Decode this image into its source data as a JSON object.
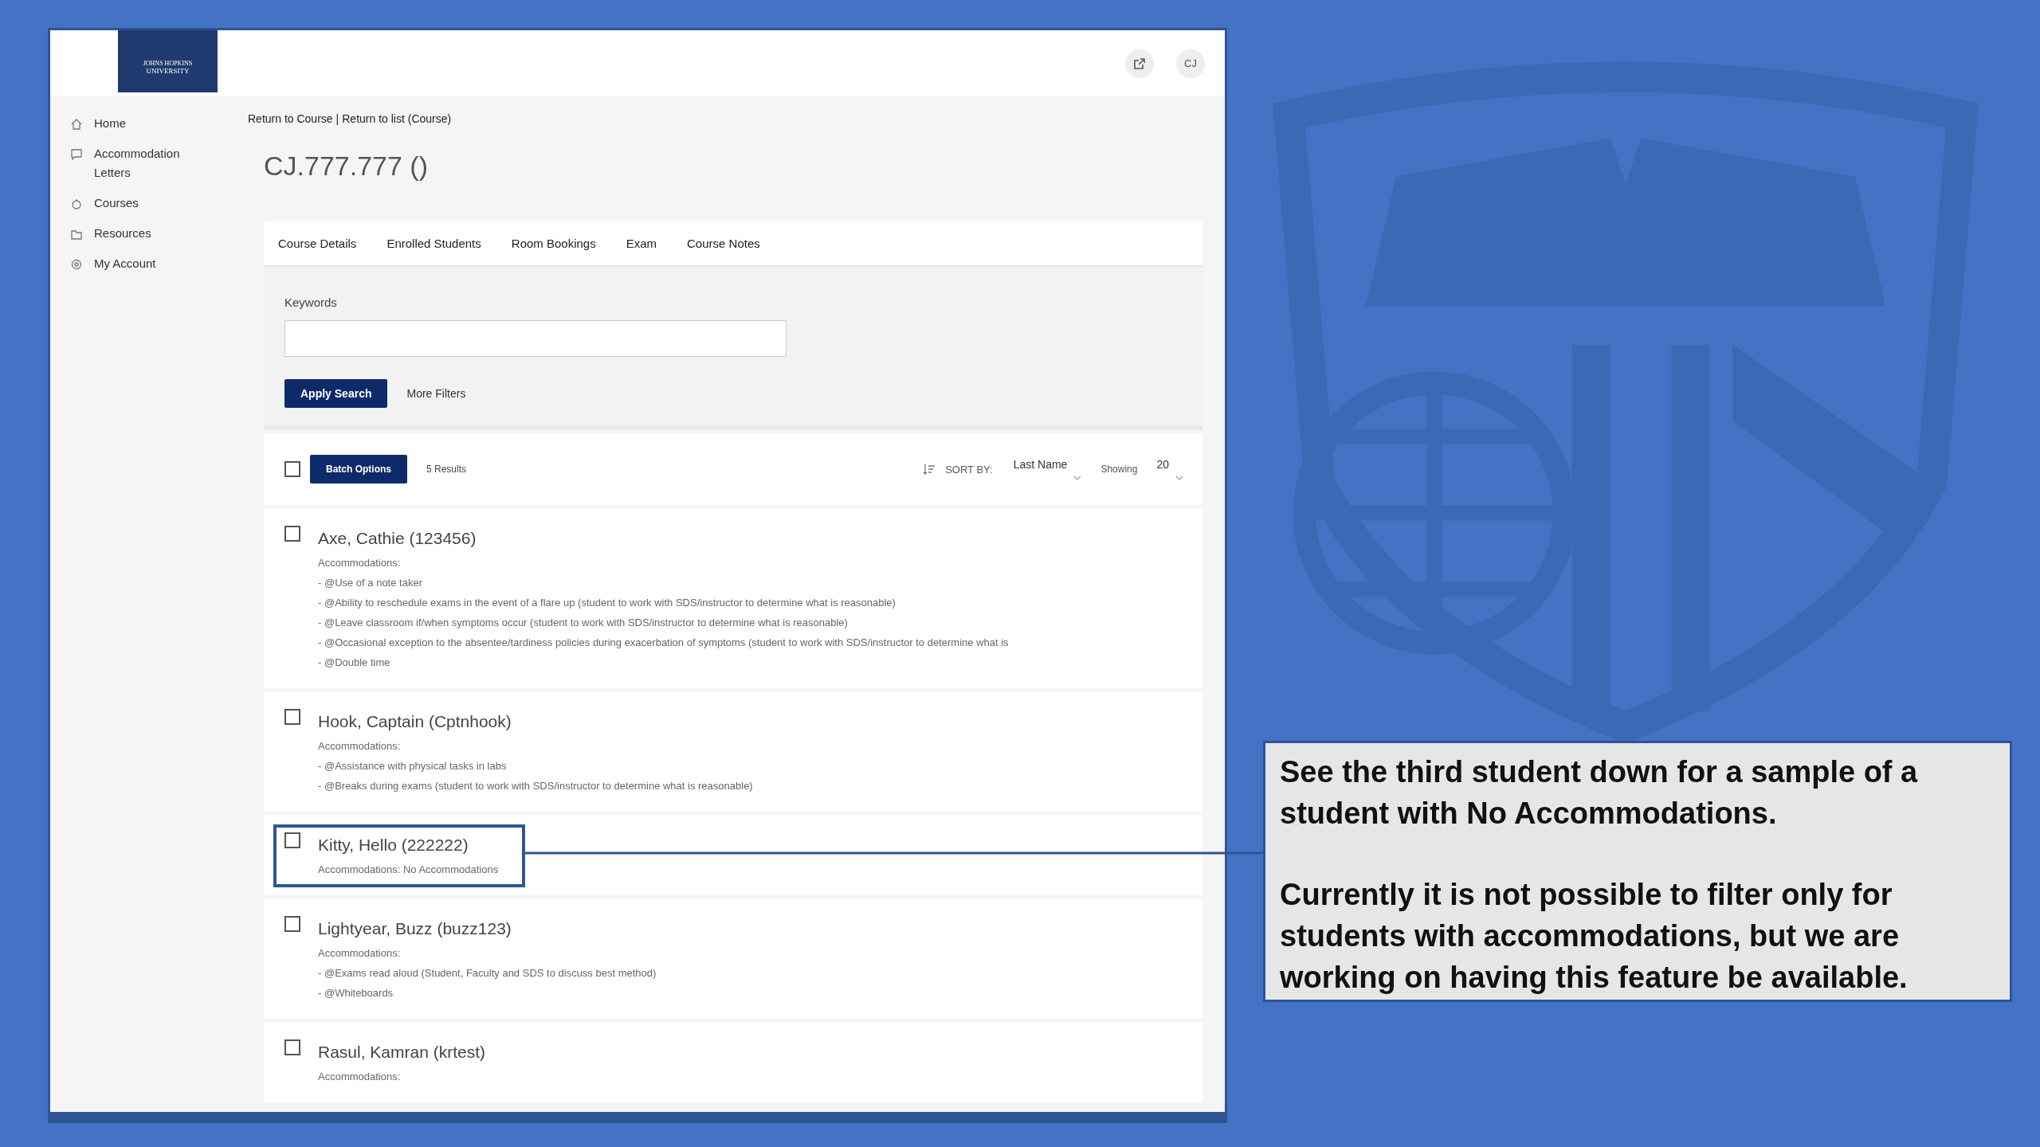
{
  "header": {
    "logo": {
      "line1": "JOHNS HOPKINS",
      "line2": "UNIVERSITY"
    },
    "avatar_initials": "CJ"
  },
  "sidebar": {
    "items": [
      {
        "label": "Home"
      },
      {
        "label": "Accommodation Letters"
      },
      {
        "label": "Courses"
      },
      {
        "label": "Resources"
      },
      {
        "label": "My Account"
      }
    ]
  },
  "breadcrumb": {
    "links": [
      "Return to Course",
      "Return to list (Course)"
    ],
    "separator": "|"
  },
  "title": "CJ.777.777 ()",
  "tabs": [
    {
      "label": "Course Details"
    },
    {
      "label": "Enrolled Students"
    },
    {
      "label": "Room Bookings"
    },
    {
      "label": "Exam"
    },
    {
      "label": "Course Notes"
    }
  ],
  "filters": {
    "keywords_label": "Keywords",
    "apply_button": "Apply Search",
    "more_filters": "More Filters"
  },
  "toolbar": {
    "select_all_checked": false,
    "batch_button": "Batch Options",
    "results": "5 Results",
    "sort_label": "SORT BY:",
    "sort_value": "Last Name",
    "showing_label": "Showing",
    "showing_value": "20"
  },
  "students": [
    {
      "name": "Axe, Cathie (123456)",
      "checked": false,
      "highlighted": false,
      "accommodations_label": "Accommodations:",
      "items": [
        "- @Use of a note taker",
        "- @Ability to reschedule exams in the event of a flare up (student to work with SDS/instructor to determine what is reasonable)",
        "- @Leave classroom if/when symptoms occur (student to work with SDS/instructor to determine what is reasonable)",
        "- @Occasional exception to the absentee/tardiness policies during exacerbation of symptoms (student to work with SDS/instructor to determine what is",
        "- @Double time"
      ]
    },
    {
      "name": "Hook, Captain (Cptnhook)",
      "checked": false,
      "highlighted": false,
      "accommodations_label": "Accommodations:",
      "items": [
        "- @Assistance with physical tasks in labs",
        "- @Breaks during exams (student to work with SDS/instructor to determine what is reasonable)"
      ]
    },
    {
      "name": "Kitty, Hello (222222)",
      "checked": false,
      "highlighted": true,
      "accommodations_label": "Accommodations: No Accommodations"
    },
    {
      "name": "Lightyear, Buzz (buzz123)",
      "checked": false,
      "highlighted": false,
      "accommodations_label": "Accommodations:",
      "items": [
        "- @Exams read aloud (Student, Faculty and SDS to discuss best method)",
        "- @Whiteboards"
      ]
    },
    {
      "name": "Rasul, Kamran (krtest)",
      "checked": false,
      "highlighted": false,
      "accommodations_label": "Accommodations:"
    }
  ],
  "callout": {
    "paragraphs": [
      "See the third student down for a sample of a student with No Accommodations.",
      "Currently it is not possible to filter only for students with accommodations, but we are working on having this feature be available."
    ]
  }
}
